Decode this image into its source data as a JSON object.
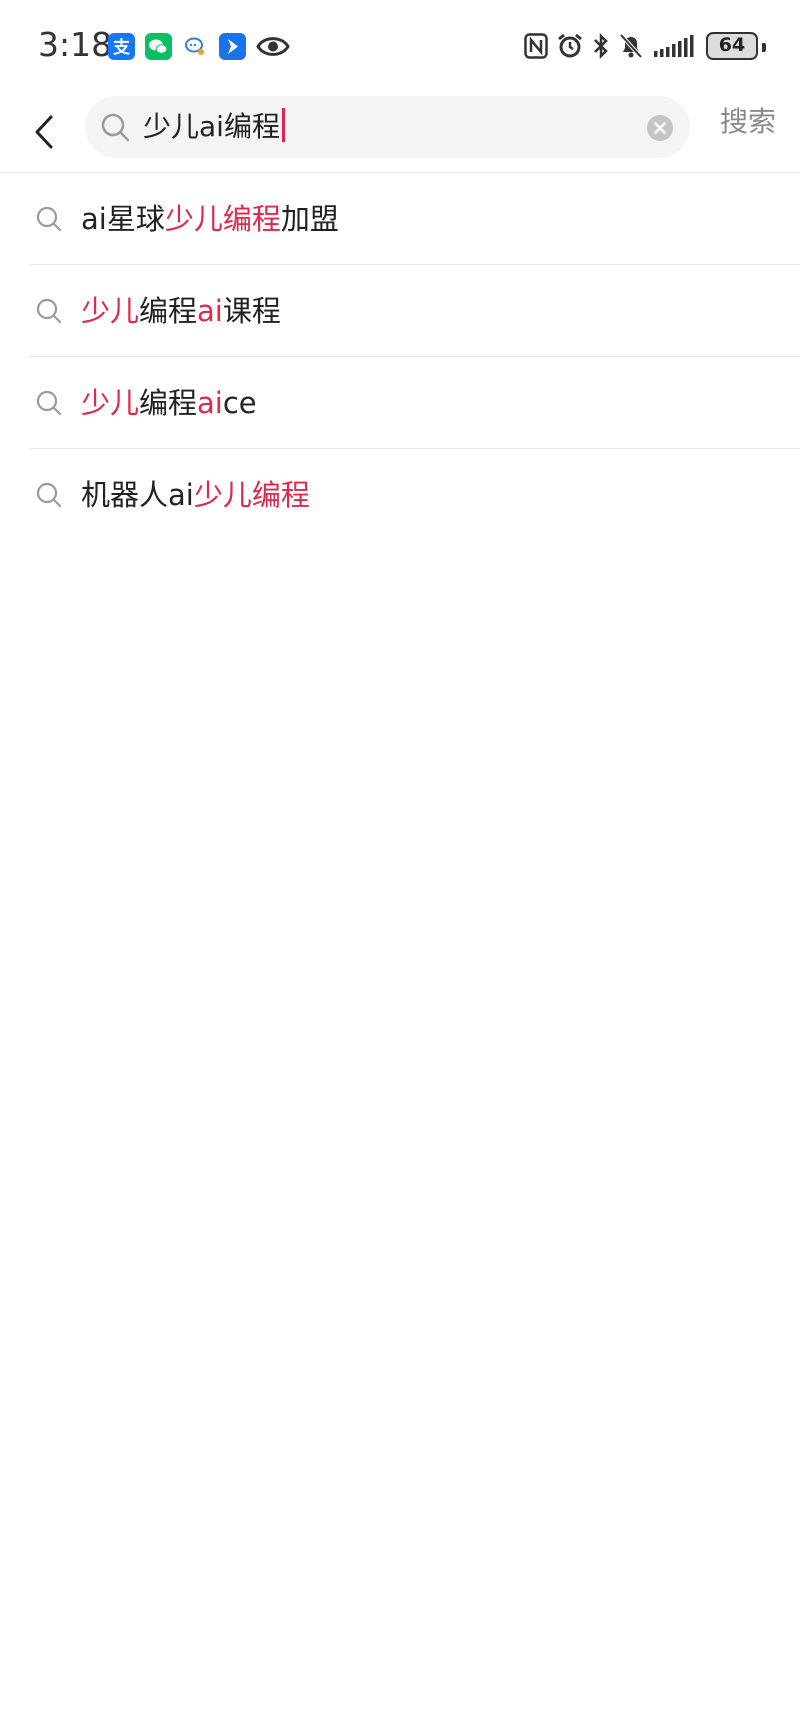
{
  "status_bar": {
    "time": "3:18",
    "battery_level": "64",
    "notification_icons": [
      "alipay-icon",
      "wechat-icon",
      "chat-bubble-icon",
      "navigation-app-icon",
      "eye-icon"
    ],
    "system_icons": [
      "nfc-icon",
      "alarm-icon",
      "bluetooth-icon",
      "bell-muted-icon",
      "signal-icon",
      "battery-icon"
    ]
  },
  "search": {
    "query": "少儿ai编程",
    "search_button_label": "搜索",
    "accent_color": "#e0284a"
  },
  "suggestions": [
    {
      "parts": [
        {
          "text": "ai星球",
          "highlight": false
        },
        {
          "text": "少儿编程",
          "highlight": true
        },
        {
          "text": "加盟",
          "highlight": false
        }
      ]
    },
    {
      "parts": [
        {
          "text": "少儿",
          "highlight": true
        },
        {
          "text": "编程",
          "highlight": false
        },
        {
          "text": "ai",
          "highlight": true
        },
        {
          "text": "课程",
          "highlight": false
        }
      ]
    },
    {
      "parts": [
        {
          "text": "少儿",
          "highlight": true
        },
        {
          "text": "编程",
          "highlight": false
        },
        {
          "text": "ai",
          "highlight": true
        },
        {
          "text": "ce",
          "highlight": false
        }
      ]
    },
    {
      "parts": [
        {
          "text": "机器人ai",
          "highlight": false
        },
        {
          "text": "少儿编程",
          "highlight": true
        }
      ]
    }
  ]
}
